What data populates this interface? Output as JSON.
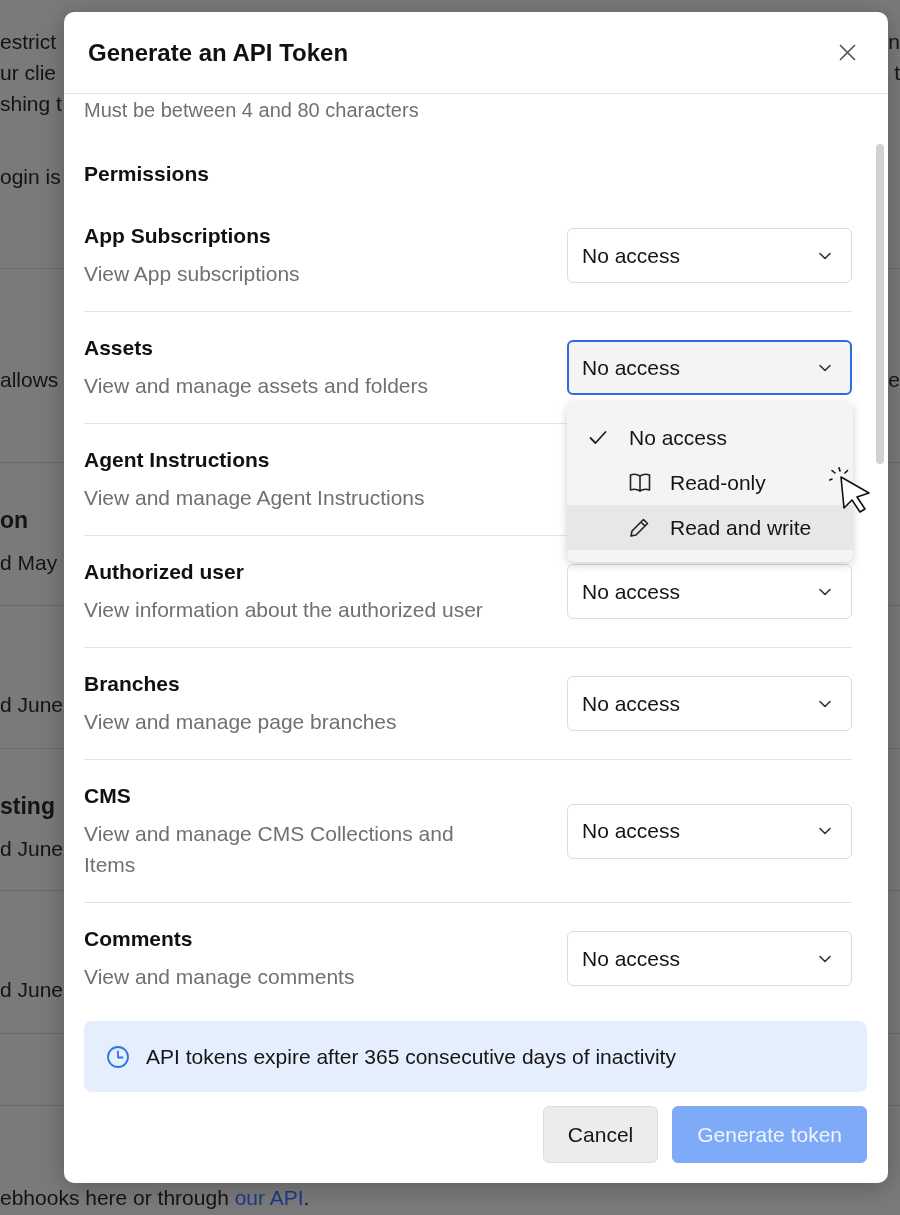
{
  "background": {
    "sections": [
      {
        "lines": [
          {
            "kind": "text",
            "left": "estrict",
            "right": "n"
          },
          {
            "kind": "text",
            "left": "ur clie",
            "right": "t"
          },
          {
            "kind": "text",
            "left": "shing t"
          },
          {
            "kind": "text",
            "left": "ogin is"
          }
        ]
      },
      {
        "lines": [
          {
            "kind": "text",
            "left": "allows",
            "right": "e"
          }
        ]
      },
      {
        "lines": [
          {
            "kind": "heading",
            "left": "on"
          },
          {
            "kind": "text",
            "left": "d May"
          }
        ]
      },
      {
        "lines": [
          {
            "kind": "text",
            "left": "d June"
          }
        ]
      },
      {
        "lines": [
          {
            "kind": "heading",
            "left": "sting"
          },
          {
            "kind": "text",
            "left": "d June"
          }
        ]
      },
      {
        "lines": [
          {
            "kind": "text",
            "left": "d June"
          }
        ]
      },
      {
        "lines": [
          {
            "kind": "link-line",
            "left": "ebhooks here or through ",
            "link": "our API",
            "after": "."
          }
        ]
      }
    ]
  },
  "dialog": {
    "title": "Generate an API Token",
    "hint": "Must be between 4 and 80 characters",
    "section_title": "Permissions",
    "permissions": [
      {
        "name": "App Subscriptions",
        "description": "View App subscriptions",
        "value": "No access",
        "open": false
      },
      {
        "name": "Assets",
        "description": "View and manage assets and folders",
        "value": "No access",
        "open": true
      },
      {
        "name": "Agent Instructions",
        "description": "View and manage Agent Instructions",
        "open": false
      },
      {
        "name": "Authorized user",
        "description": "View information about the authorized user",
        "value": "No access",
        "open": false
      },
      {
        "name": "Branches",
        "description": "View and manage page branches",
        "value": "No access",
        "open": false
      },
      {
        "name": "CMS",
        "description": "View and manage CMS Collections and Items",
        "value": "No access",
        "open": false
      },
      {
        "name": "Comments",
        "description": "View and manage comments",
        "value": "No access",
        "open": false
      }
    ],
    "menu": {
      "options": [
        {
          "label": "No access",
          "selected": true,
          "hovered": false
        },
        {
          "label": "Read-only",
          "selected": false,
          "hovered": false
        },
        {
          "label": "Read and write",
          "selected": false,
          "hovered": true
        }
      ]
    },
    "notice": "API tokens expire after 365 consecutive days of inactivity",
    "buttons": [
      {
        "label": "Cancel",
        "kind": "secondary",
        "disabled": false
      },
      {
        "label": "Generate token",
        "kind": "primary",
        "disabled": true
      }
    ]
  }
}
